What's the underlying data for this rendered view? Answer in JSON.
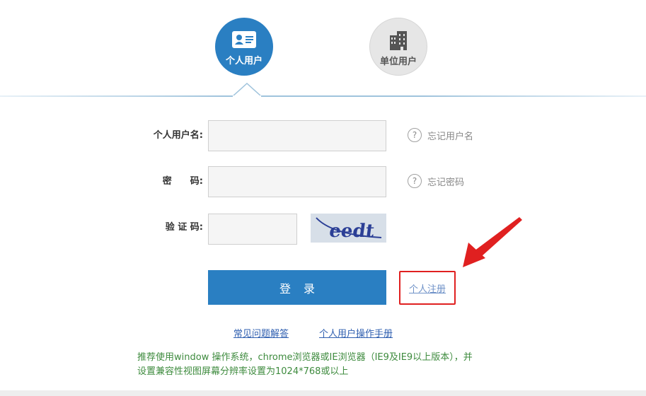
{
  "tabs": {
    "personal": {
      "label": "个人用户",
      "icon": "id-card-icon"
    },
    "company": {
      "label": "单位用户",
      "icon": "building-icon"
    }
  },
  "form": {
    "username_label": "个人用户名:",
    "password_label": "密　　码:",
    "captcha_label": "验 证 码:",
    "username_value": "",
    "password_value": "",
    "captcha_value": "",
    "forgot_username": "忘记用户名",
    "forgot_password": "忘记密码",
    "help_icon": "question-circle-icon",
    "captcha_text": "eedt"
  },
  "actions": {
    "login_label": "登录",
    "register_label": "个人注册"
  },
  "links": {
    "faq": "常见问题解答",
    "manual": "个人用户操作手册"
  },
  "note": {
    "line1": "推荐使用window 操作系统，chrome浏览器或IE浏览器（IE9及IE9以上版本），并",
    "line2": "设置兼容性视图屏幕分辨率设置为1024*768或以上"
  },
  "colors": {
    "primary": "#2a7fc2",
    "annotation_red": "#e02020",
    "note_green": "#3e8b3e"
  }
}
